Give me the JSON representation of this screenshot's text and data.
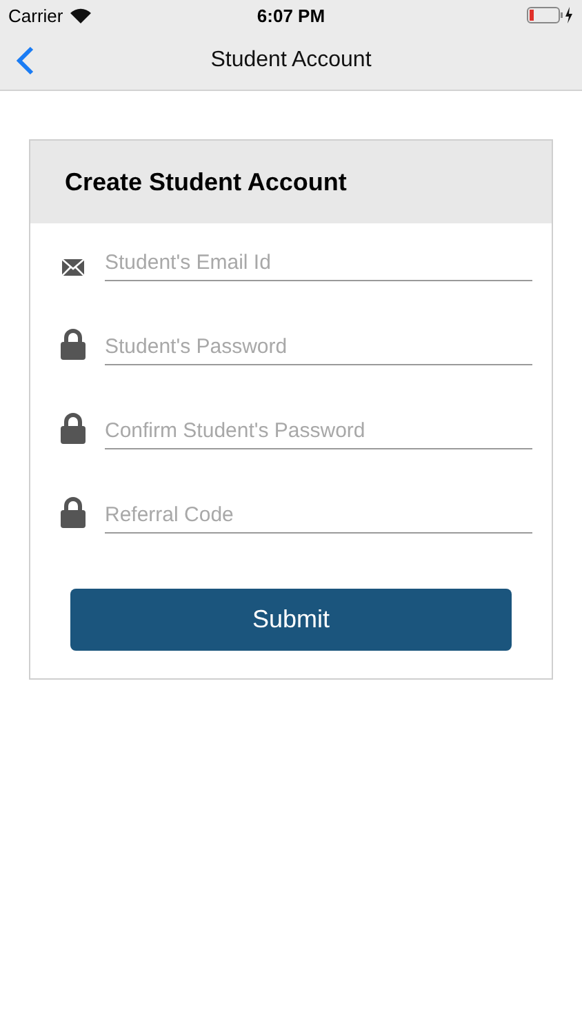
{
  "status_bar": {
    "carrier": "Carrier",
    "time": "6:07 PM"
  },
  "nav_bar": {
    "title": "Student Account"
  },
  "card": {
    "title": "Create Student Account",
    "fields": [
      {
        "kind": "email",
        "placeholder": "Student's Email Id"
      },
      {
        "kind": "lock",
        "placeholder": "Student's Password"
      },
      {
        "kind": "lock",
        "placeholder": "Confirm Student's Password"
      },
      {
        "kind": "lock",
        "placeholder": "Referral Code"
      }
    ],
    "submit": "Submit"
  }
}
